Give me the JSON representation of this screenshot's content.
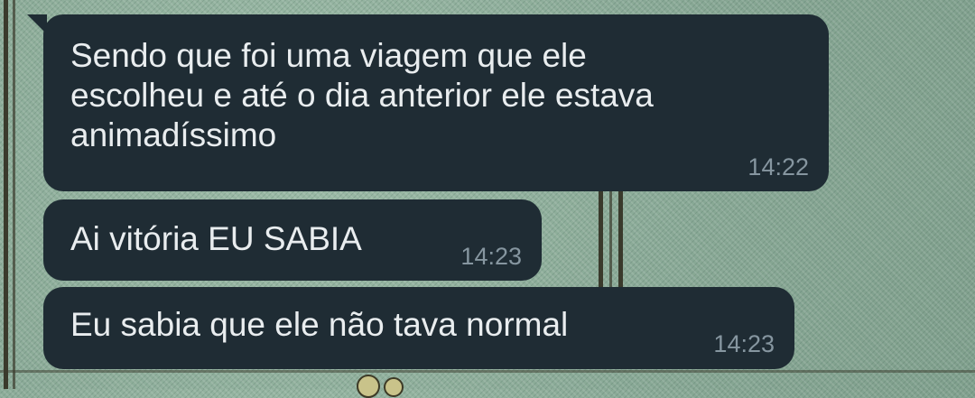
{
  "chat": {
    "messages": [
      {
        "text": "Sendo que foi uma viagem que ele\nescolheu e até o dia anterior ele estava\nanimadíssimo",
        "time": "14:22"
      },
      {
        "text": "Ai vitória EU SABIA",
        "time": "14:23"
      },
      {
        "text": "Eu sabia que ele não tava normal",
        "time": "14:23"
      }
    ]
  },
  "colors": {
    "bubble_background": "#1f2c34",
    "message_text": "#e9edef",
    "timestamp_text": "#8696a0",
    "wallpaper": "#8fae9c"
  }
}
